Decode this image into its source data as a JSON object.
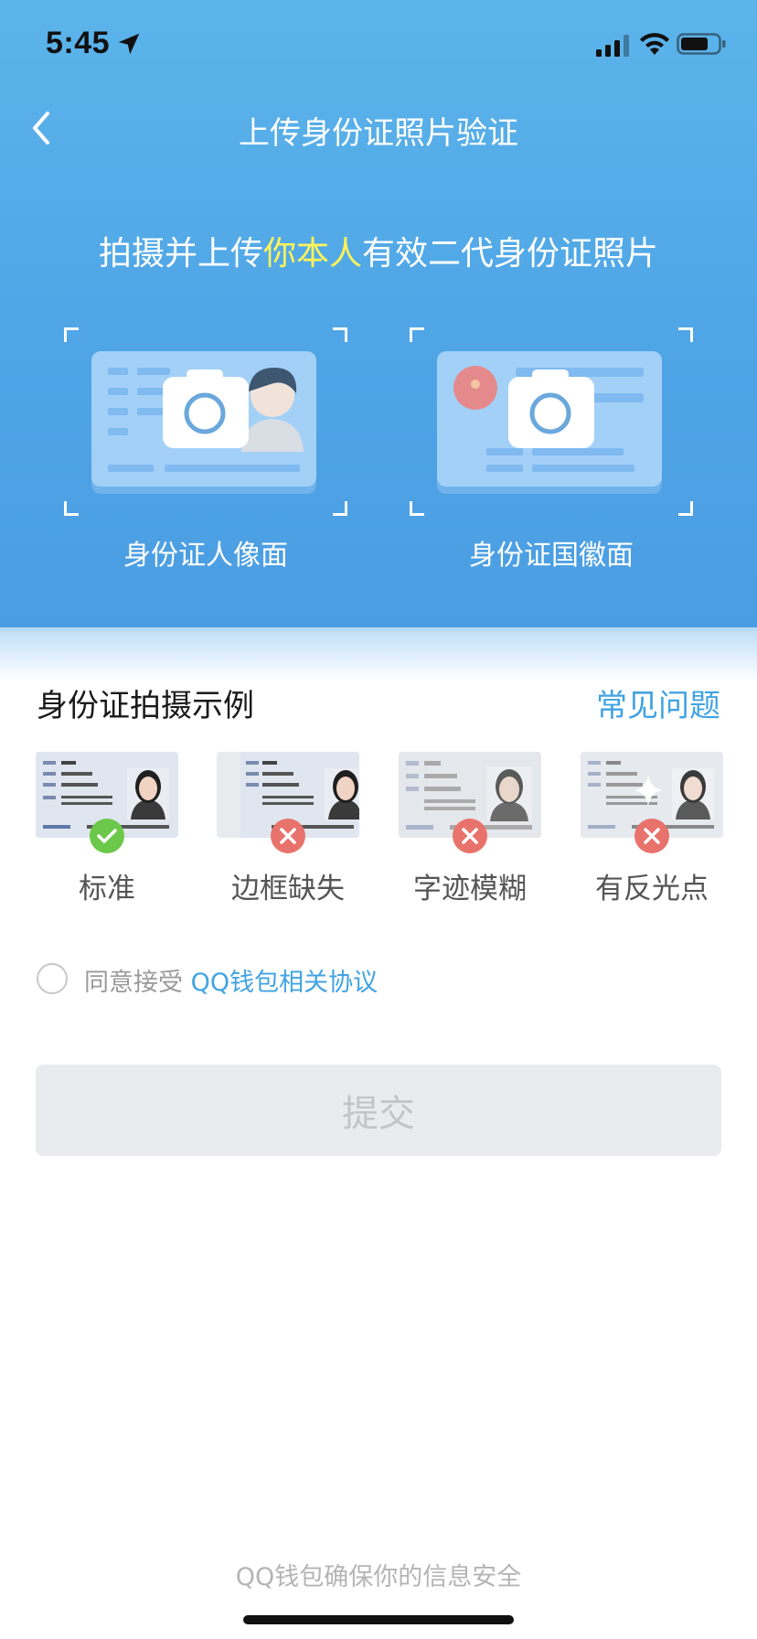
{
  "status_bar": {
    "time": "5:45",
    "icons": [
      "location-arrow-icon",
      "cellular-signal-icon",
      "wifi-icon",
      "battery-icon"
    ]
  },
  "nav": {
    "back_icon": "chevron-left-icon",
    "title": "上传身份证照片验证"
  },
  "hero": {
    "headline_prefix": "拍摄并上传",
    "headline_highlight": "你本人",
    "headline_suffix": "有效二代身份证照片",
    "highlight_color": "#fff35a",
    "slots": [
      {
        "label": "身份证人像面",
        "icon": "id-portrait-camera-icon"
      },
      {
        "label": "身份证国徽面",
        "icon": "id-emblem-camera-icon"
      }
    ]
  },
  "examples": {
    "title": "身份证拍摄示例",
    "faq_label": "常见问题",
    "items": [
      {
        "label": "标准",
        "status": "ok",
        "badge_icon": "check-icon"
      },
      {
        "label": "边框缺失",
        "status": "bad",
        "badge_icon": "cross-icon"
      },
      {
        "label": "字迹模糊",
        "status": "bad",
        "badge_icon": "cross-icon"
      },
      {
        "label": "有反光点",
        "status": "bad",
        "badge_icon": "cross-icon"
      }
    ]
  },
  "agreement": {
    "checked": false,
    "text": "同意接受 ",
    "link": "QQ钱包相关协议"
  },
  "submit": {
    "label": "提交",
    "enabled": false
  },
  "footer": {
    "note": "QQ钱包确保你的信息安全"
  },
  "colors": {
    "accent": "#41a3e2",
    "hero_top": "#5cb4ea",
    "ok_badge": "#6cc84a",
    "bad_badge": "#e8736c"
  }
}
